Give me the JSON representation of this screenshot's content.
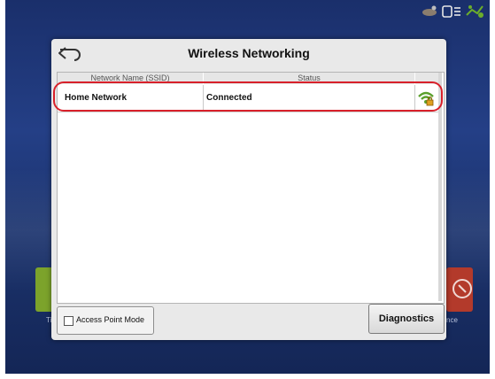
{
  "dialog": {
    "title": "Wireless Networking"
  },
  "table": {
    "columns": [
      "Network Name (SSID)",
      "Status"
    ],
    "rows": [
      {
        "ssid": "Home Network",
        "status": "Connected",
        "signal_icon": "wifi-lock-icon"
      }
    ]
  },
  "footer": {
    "access_point_label": "Access Point Mode",
    "access_point_checked": false,
    "diagnostics_label": "Diagnostics"
  },
  "background": {
    "left_tile_label": "Ti",
    "right_tile_label": "nce"
  },
  "colors": {
    "highlight": "#d8202a",
    "wifi": "#5aa02c",
    "lock": "#e0a020"
  }
}
